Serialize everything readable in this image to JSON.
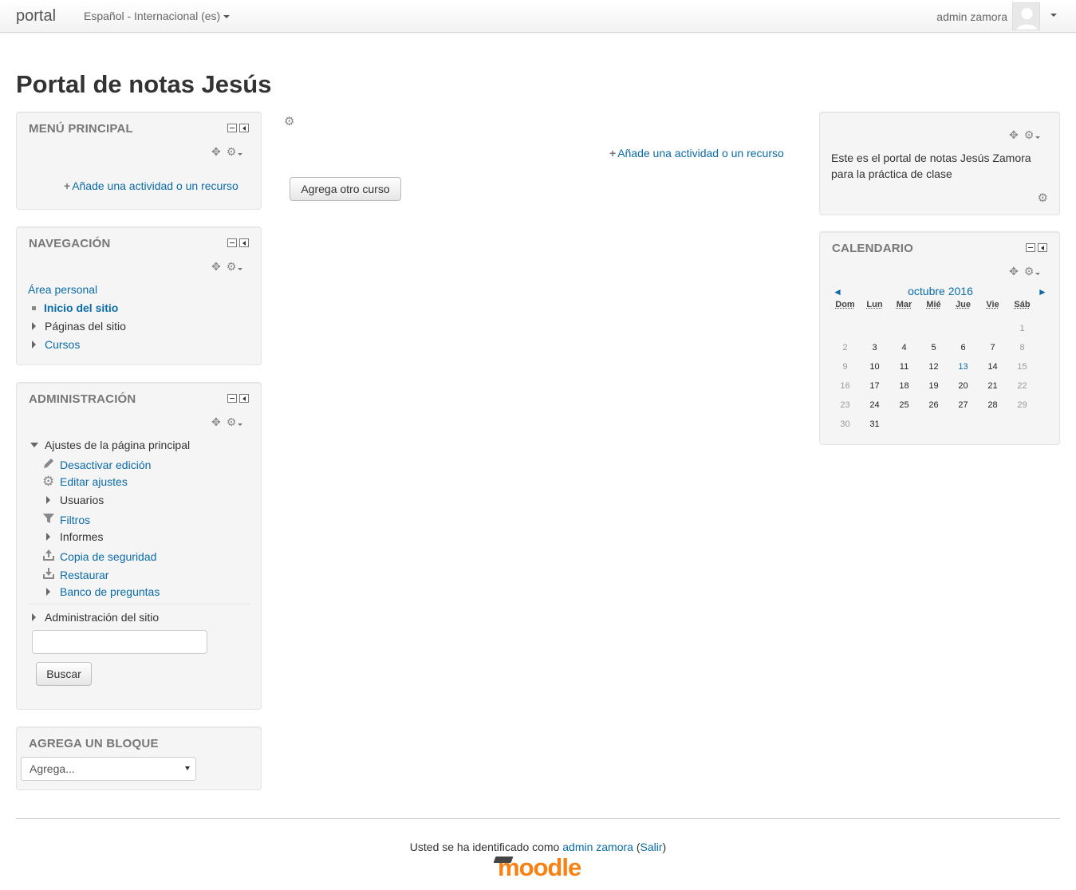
{
  "navbar": {
    "brand": "portal",
    "language": "Español - Internacional (es)",
    "user_name": "admin zamora"
  },
  "page": {
    "title": "Portal de notas Jesús"
  },
  "main_menu": {
    "title": "MENÚ PRINCIPAL",
    "add_activity": "Añade una actividad o un recurso"
  },
  "navigation": {
    "title": "NAVEGACIÓN",
    "personal_area": "Área personal",
    "site_home": "Inicio del sitio",
    "site_pages": "Páginas del sitio",
    "courses": "Cursos"
  },
  "administration": {
    "title": "ADMINISTRACIÓN",
    "frontpage_settings": "Ajustes de la página principal",
    "items": [
      {
        "label": "Desactivar edición",
        "icon": "pencil-icon",
        "link": true
      },
      {
        "label": "Editar ajustes",
        "icon": "gear-icon",
        "link": true
      },
      {
        "label": "Usuarios",
        "icon": "expand-arrow-icon",
        "link": false
      },
      {
        "label": "Filtros",
        "icon": "filter-icon",
        "link": true
      },
      {
        "label": "Informes",
        "icon": "expand-arrow-icon",
        "link": false
      },
      {
        "label": "Copia de seguridad",
        "icon": "backup-icon",
        "link": true
      },
      {
        "label": "Restaurar",
        "icon": "restore-icon",
        "link": true
      },
      {
        "label": "Banco de preguntas",
        "icon": "expand-arrow-icon",
        "link": true
      }
    ],
    "site_admin": "Administración del sitio",
    "search_value": "",
    "search_button": "Buscar"
  },
  "add_block": {
    "title": "AGREGA UN BLOQUE",
    "select_value": "Agrega..."
  },
  "center": {
    "add_activity": "Añade una actividad o un recurso",
    "add_course_button": "Agrega otro curso"
  },
  "html_block": {
    "text_line1": "Este es el portal de notas Jesús Zamora",
    "text_line2": "para la práctica de clase"
  },
  "calendar": {
    "title": "CALENDARIO",
    "month": "octubre 2016",
    "prev": "◄",
    "next": "►",
    "weekdays": [
      "Dom",
      "Lun",
      "Mar",
      "Mié",
      "Jue",
      "Vie",
      "Sáb"
    ],
    "weeks": [
      [
        "",
        "",
        "",
        "",
        "",
        "",
        "1"
      ],
      [
        "2",
        "3",
        "4",
        "5",
        "6",
        "7",
        "8"
      ],
      [
        "9",
        "10",
        "11",
        "12",
        "13",
        "14",
        "15"
      ],
      [
        "16",
        "17",
        "18",
        "19",
        "20",
        "21",
        "22"
      ],
      [
        "23",
        "24",
        "25",
        "26",
        "27",
        "28",
        "29"
      ],
      [
        "30",
        "31",
        "",
        "",
        "",
        "",
        ""
      ]
    ],
    "today": "13"
  },
  "footer": {
    "logged_in_prefix": "Usted se ha identificado como ",
    "user_link": "admin zamora",
    "logout_open": " (",
    "logout_link": "Salir",
    "logout_close": ")",
    "logo": "moodle"
  },
  "colors": {
    "link": "#0a6ba8",
    "moodle_orange": "#f98012",
    "block_bg": "#f5f5f5"
  }
}
